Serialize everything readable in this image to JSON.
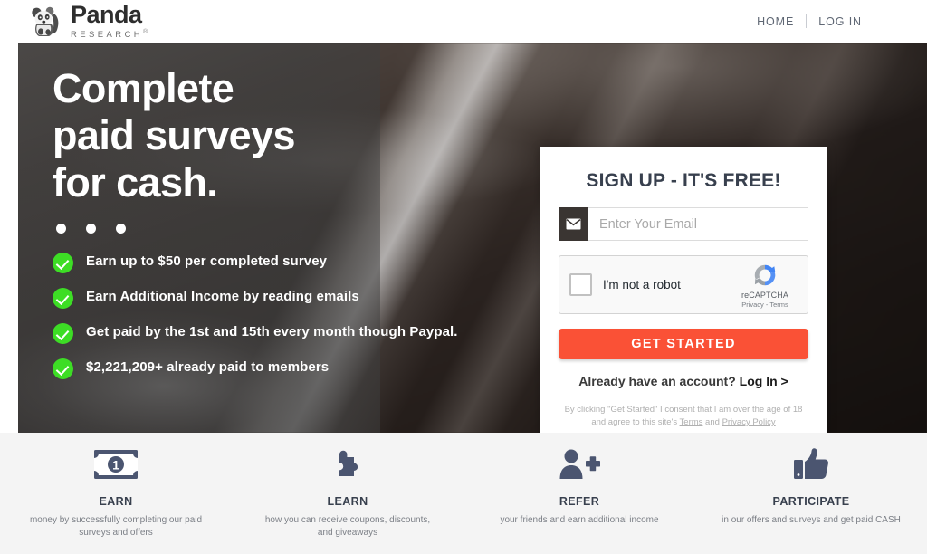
{
  "header": {
    "brand_name": "Panda",
    "brand_sub": "RESEARCH",
    "brand_reg": "®",
    "brand_icon": "panda-logo-icon",
    "nav": [
      {
        "label": "HOME",
        "name": "nav-home"
      },
      {
        "label": "LOG IN",
        "name": "nav-login"
      }
    ]
  },
  "hero": {
    "title_line1": "Complete",
    "title_line2": "paid surveys",
    "title_line3": "for cash.",
    "slider_dots": 3,
    "bullets": [
      "Earn up to $50 per completed survey",
      "Earn Additional Income by reading emails",
      "Get paid by the 1st and 15th every month though Paypal.",
      "$2,221,209+ already paid to members"
    ],
    "check_color": "#3ddd25"
  },
  "signup": {
    "title": "SIGN UP - IT'S FREE!",
    "email_icon": "envelope-icon",
    "email_value": "",
    "email_placeholder": "Enter Your Email",
    "captcha": {
      "label": "I'm not a robot",
      "brand": "reCAPTCHA",
      "legal": "Privacy - Terms",
      "logo_icon": "recaptcha-icon",
      "checked": false
    },
    "cta_label": "GET STARTED",
    "cta_color": "#fa5136",
    "already_text": "Already have an account?",
    "already_link": "Log In >",
    "fineprint_line1": "By clicking \"Get Started\" I consent that I am over the age of 18",
    "fineprint_line2_pre": "and agree to this site's ",
    "fineprint_terms": "Terms",
    "fineprint_mid": " and ",
    "fineprint_privacy": "Privacy Policy"
  },
  "features": [
    {
      "icon": "dollar-bill-icon",
      "title": "EARN",
      "desc": "money by successfully completing our paid surveys and offers"
    },
    {
      "icon": "puzzle-piece-icon",
      "title": "LEARN",
      "desc": "how you can receive coupons, discounts, and giveaways"
    },
    {
      "icon": "add-person-icon",
      "title": "REFER",
      "desc": "your friends and earn additional income"
    },
    {
      "icon": "thumbs-up-icon",
      "title": "PARTICIPATE",
      "desc": "in our offers and surveys and get paid CASH"
    }
  ]
}
